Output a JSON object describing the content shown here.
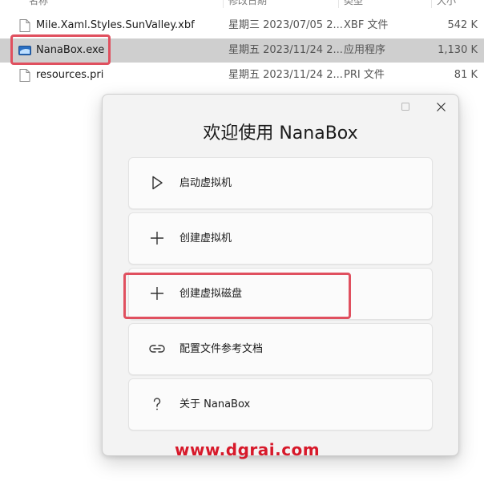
{
  "explorer": {
    "columns": {
      "name": "名称",
      "date": "修改日期",
      "type": "类型",
      "size": "大小"
    },
    "files": [
      {
        "name": "Mile.Xaml.Styles.SunValley.xbf",
        "date": "星期三 2023/07/05 2...",
        "type": "XBF 文件",
        "size": "542 K",
        "icon": "file-icon",
        "selected": false
      },
      {
        "name": "NanaBox.exe",
        "date": "星期五 2023/11/24 2...",
        "type": "应用程序",
        "size": "1,130 K",
        "icon": "app-icon",
        "selected": true
      },
      {
        "name": "resources.pri",
        "date": "星期五 2023/11/24 2...",
        "type": "PRI 文件",
        "size": "81 K",
        "icon": "file-icon",
        "selected": false
      }
    ]
  },
  "dialog": {
    "title": "欢迎使用 NanaBox",
    "window_controls": {
      "minimize": "—",
      "maximize": "☐",
      "close": "✕"
    },
    "menu": [
      {
        "label": "启动虚拟机",
        "icon": "play-icon"
      },
      {
        "label": "创建虚拟机",
        "icon": "plus-icon"
      },
      {
        "label": "创建虚拟磁盘",
        "icon": "plus-icon"
      },
      {
        "label": "配置文件参考文档",
        "icon": "link-icon"
      },
      {
        "label": "关于 NanaBox",
        "icon": "help-icon"
      }
    ]
  },
  "watermark": "www.dgrai.com",
  "colors": {
    "highlight": "#e0505f",
    "watermark": "#d7192a",
    "selection": "#cfcfcf"
  }
}
